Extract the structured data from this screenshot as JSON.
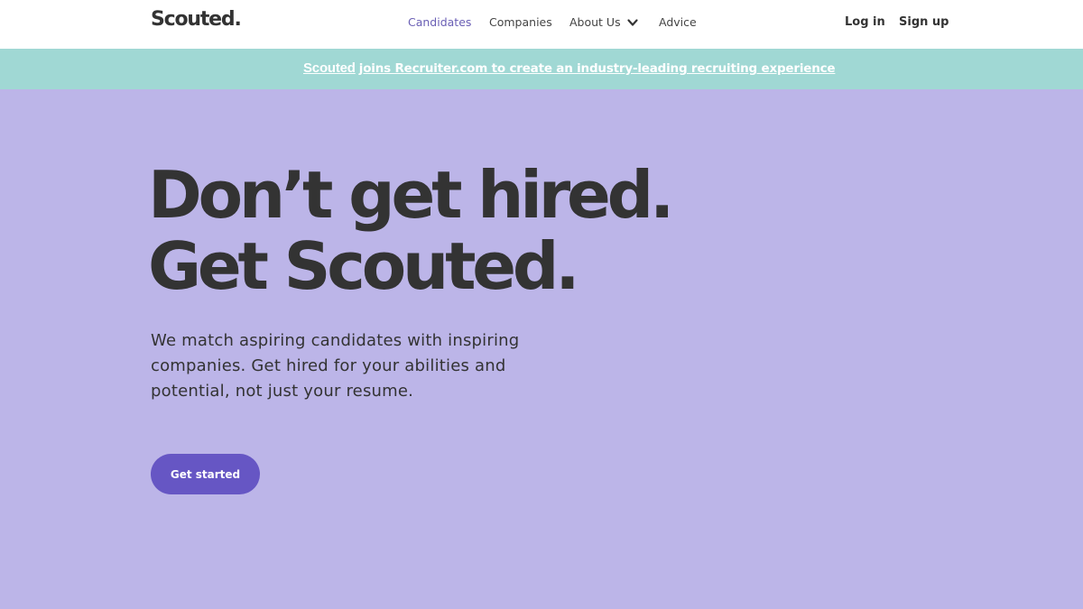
{
  "header": {
    "logo": "Scouted.",
    "nav": {
      "candidates": "Candidates",
      "companies": "Companies",
      "about": "About Us",
      "advice": "Advice"
    },
    "login": "Log in",
    "signup": "Sign up"
  },
  "banner": {
    "brand": "Scouted",
    "text": "joins Recruiter.com to create an industry-leading recruiting experience"
  },
  "hero": {
    "headline_line1": "Don’t get hired.",
    "headline_line2": "Get Scouted.",
    "subtext": "We match aspiring candidates with inspiring companies. Get hired for your abilities and potential, not just your resume.",
    "cta": "Get started"
  },
  "colors": {
    "hero_bg": "#bcb5e8",
    "banner_bg": "#a0d8d4",
    "cta_bg": "#6656c4",
    "active_nav": "#6a5fb5",
    "text": "#333333"
  }
}
